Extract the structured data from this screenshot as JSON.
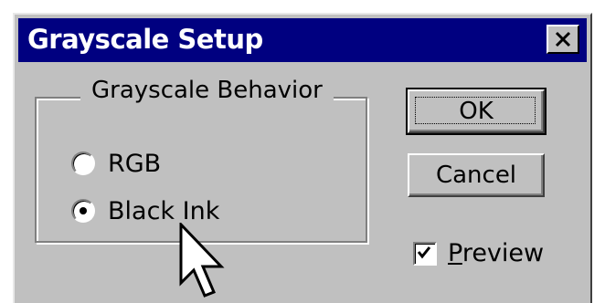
{
  "window": {
    "title": "Grayscale Setup",
    "close_icon": "close-icon"
  },
  "group": {
    "title": "Grayscale Behavior",
    "options": [
      {
        "label": "RGB",
        "selected": false
      },
      {
        "label": "Black Ink",
        "selected": true
      }
    ]
  },
  "buttons": {
    "ok": "OK",
    "cancel": "Cancel"
  },
  "preview": {
    "mnemonic": "P",
    "rest": "review",
    "checked": true
  },
  "colors": {
    "titlebar": "#000080",
    "face": "#c0c0c0"
  }
}
